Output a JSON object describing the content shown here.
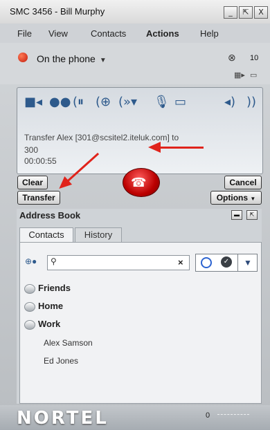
{
  "window": {
    "title": "SMC 3456 - Bill Murphy",
    "controls": {
      "minimize": "_",
      "restore": "⇱",
      "close": "X"
    }
  },
  "menu": [
    "File",
    "View",
    "Contacts",
    "Actions",
    "Help"
  ],
  "status": {
    "presence_label": "On the phone",
    "voicemail_count": "10"
  },
  "call": {
    "toolbar_icons": [
      "video-icon",
      "conference-icon",
      "hold-icon",
      "add-call-icon",
      "transfer-signal-icon",
      "microphone-icon",
      "keypad-icon",
      "speaker-icon",
      "volume-icon"
    ],
    "message_line1": "Transfer Alex [301@scsitel2.iteluk.com] to",
    "message_line2": "300",
    "duration": "00:00:55",
    "clear_label": "Clear",
    "transfer_label": "Transfer",
    "cancel_label": "Cancel",
    "options_label": "Options"
  },
  "address_book": {
    "title": "Address Book",
    "tabs": [
      "Contacts",
      "History"
    ],
    "search": {
      "value": "",
      "placeholder": ""
    },
    "groups": [
      "Friends",
      "Home",
      "Work"
    ],
    "contacts": [
      "Alex Samson",
      "Ed Jones"
    ]
  },
  "footer": {
    "brand": "NORTEL",
    "level": "0"
  },
  "annotation_colors": {
    "arrow": "#e0231b"
  }
}
